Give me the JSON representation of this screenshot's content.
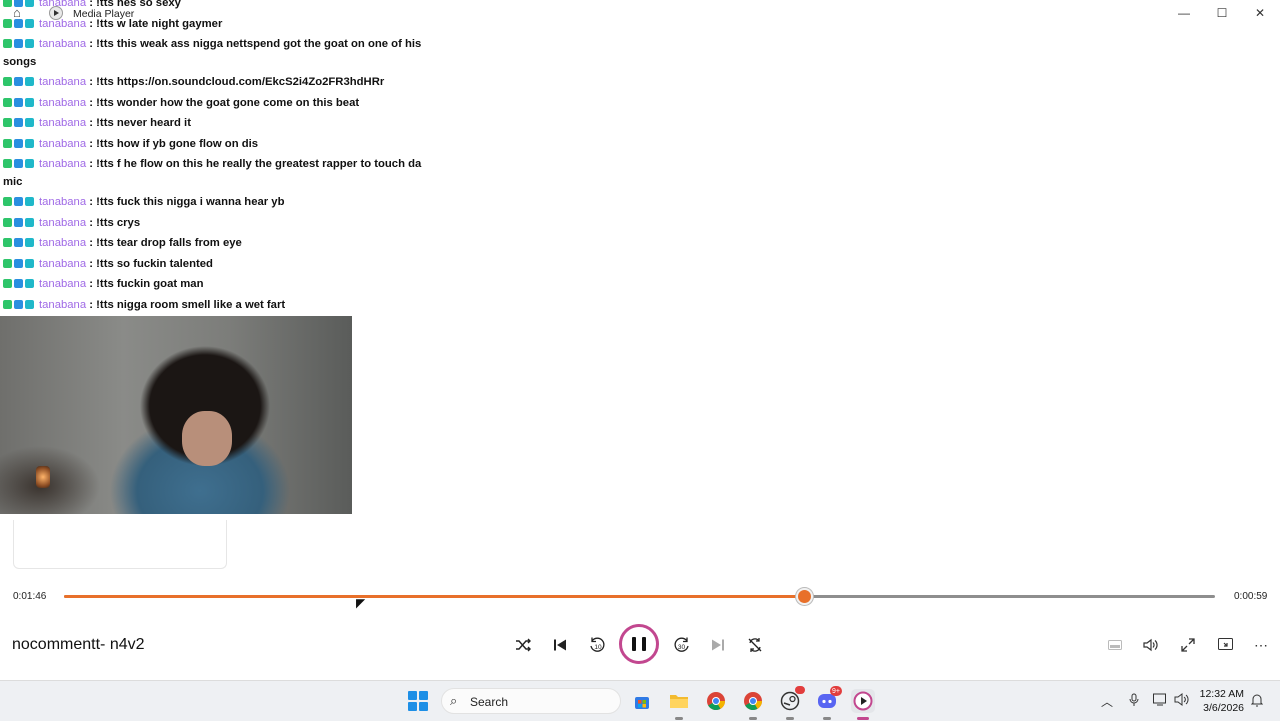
{
  "window": {
    "title": "Media Player",
    "controls": {
      "minimize": "—",
      "maximize": "☐",
      "close": "✕"
    }
  },
  "chat": [
    {
      "user": "tanabana",
      "text": ": !tts hes so sexy"
    },
    {
      "user": "tanabana",
      "text": ": !tts w late night gaymer"
    },
    {
      "user": "tanabana",
      "text": ": !tts this weak ass nigga nettspend got the goat on one of his songs"
    },
    {
      "user": "tanabana",
      "text": ": !tts https://on.soundcloud.com/EkcS2i4Zo2FR3hdHRr"
    },
    {
      "user": "tanabana",
      "text": ": !tts wonder how the goat gone come on this beat"
    },
    {
      "user": "tanabana",
      "text": ": !tts never heard it"
    },
    {
      "user": "tanabana",
      "text": ": !tts how if yb gone flow on dis"
    },
    {
      "user": "tanabana",
      "text": ": !tts f he flow on this he really the greatest rapper to touch da mic"
    },
    {
      "user": "tanabana",
      "text": ": !tts fuck this nigga i wanna hear yb"
    },
    {
      "user": "tanabana",
      "text": ": !tts crys"
    },
    {
      "user": "tanabana",
      "text": ": !tts tear drop falls from eye"
    },
    {
      "user": "tanabana",
      "text": ": !tts so fuckin talented"
    },
    {
      "user": "tanabana",
      "text": ": !tts fuckin goat man"
    },
    {
      "user": "tanabana",
      "text": ": !tts nigga room smell like a wet fart"
    }
  ],
  "player": {
    "elapsed": "0:01:46",
    "remaining": "0:00:59",
    "progress": 0.643,
    "accent_color": "#e8702a",
    "track_title": "nocommentt- n4v2",
    "controls": {
      "shuffle": "shuffle-icon",
      "previous": "previous-icon",
      "skip_back": "⟲",
      "skip_back_label": "10",
      "pause": "pause-icon",
      "skip_forward_label": "30",
      "next": "next-icon",
      "repeat": "repeat-icon"
    },
    "right_controls": [
      "miniplayer-icon",
      "volume-icon",
      "fullscreen-icon",
      "cast-icon",
      "more-icon"
    ]
  },
  "taskbar": {
    "search_label": "Search",
    "apps": [
      "microsoft-store-icon",
      "file-explorer-icon",
      "chrome-icon",
      "chrome-profile-icon",
      "steam-icon",
      "discord-icon",
      "media-player-icon"
    ],
    "discord_badge": "9+",
    "clock_time": "12:32 AM",
    "clock_date": "3/6/2026"
  }
}
